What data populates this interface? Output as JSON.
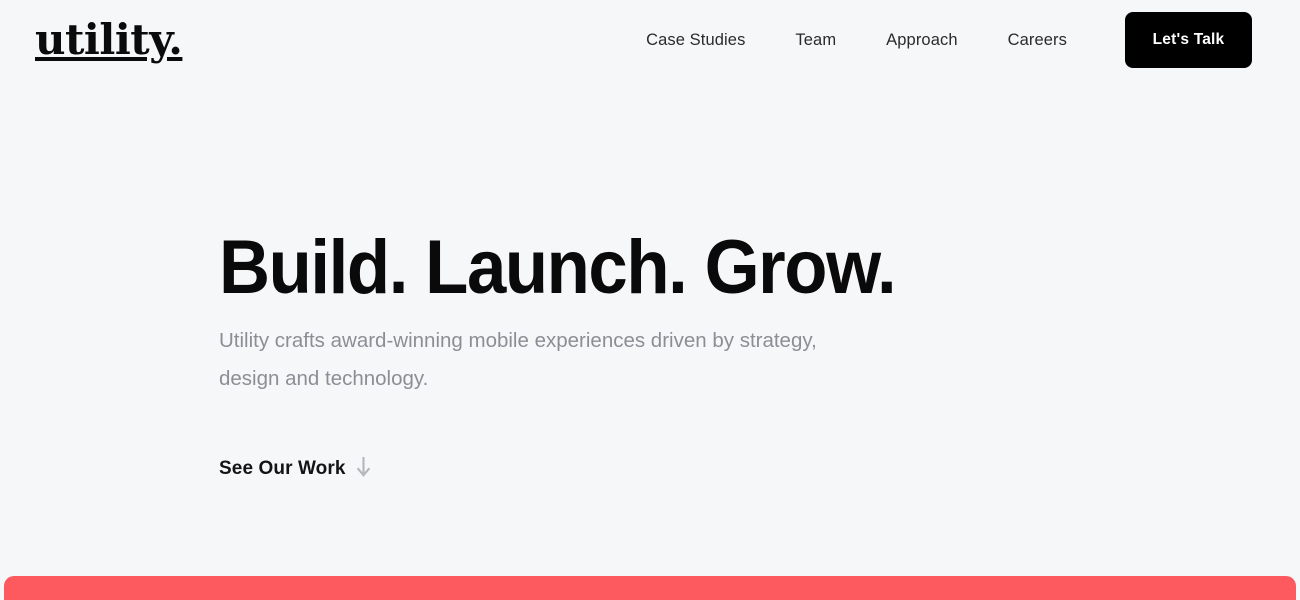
{
  "site": {
    "brand": "utility.",
    "background_color": "#f6f7f9"
  },
  "header": {
    "nav_items": [
      {
        "label": "Case Studies"
      },
      {
        "label": "Team"
      },
      {
        "label": "Approach"
      },
      {
        "label": "Careers"
      }
    ],
    "cta": {
      "label": "Let's Talk",
      "background_color": "#000000",
      "text_color": "#ffffff"
    }
  },
  "hero": {
    "headline": "Build. Launch. Grow.",
    "subheadline": "Utility crafts award-winning mobile experiences driven by strategy, design and technology.",
    "cta_label": "See Our Work",
    "cta_icon": "arrow-down-icon",
    "cta_icon_glyph": "↓",
    "headline_color": "#0a0a0a",
    "subheadline_color": "#8b8f94"
  },
  "bottom_band": {
    "color": "#fc5a5f"
  }
}
